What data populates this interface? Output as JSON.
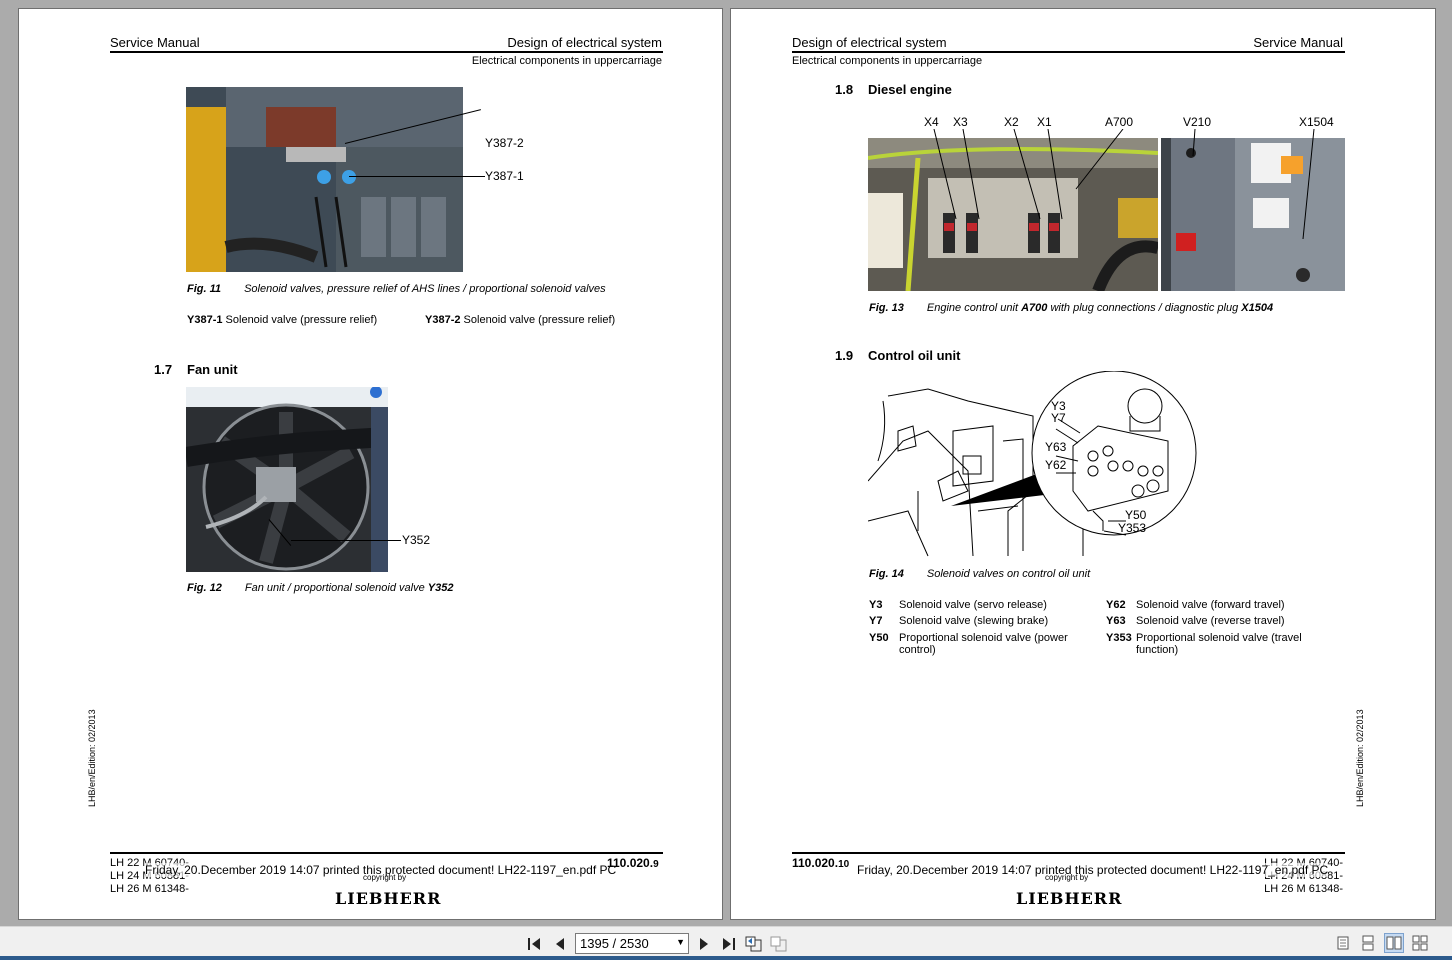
{
  "left_page": {
    "header_left": "Service Manual",
    "header_right": "Design of electrical system",
    "header_sub": "Electrical components in uppercarriage",
    "fig11": {
      "callouts": [
        "Y387-2",
        "Y387-1"
      ],
      "label": "Fig. 11",
      "caption": "Solenoid valves, pressure relief of AHS lines / proportional solenoid valves",
      "legend": [
        {
          "code": "Y387-1",
          "text": "Solenoid valve (pressure relief)"
        },
        {
          "code": "Y387-2",
          "text": "Solenoid valve (pressure relief)"
        }
      ]
    },
    "section": {
      "number": "1.7",
      "title": "Fan unit"
    },
    "fig12": {
      "callout": "Y352",
      "label": "Fig. 12",
      "caption": "Fan unit / proportional solenoid valve",
      "caption_bold": "Y352"
    },
    "side_text": "LHB/en/Edition: 02/2013",
    "footer_models": [
      "LH 22 M 60740-",
      "LH 24 M 60881-",
      "LH 26 M 61348-"
    ],
    "page_number": "110.020.",
    "page_number_small": "9",
    "copyright": "copyright by",
    "logo": "LIEBHERR",
    "printed": "Friday, 20.December 2019 14:07 printed this protected document! LH22-1197_en.pdf PC"
  },
  "right_page": {
    "header_left": "Design of electrical system",
    "header_right": "Service Manual",
    "header_sub": "Electrical components in uppercarriage",
    "section18": {
      "number": "1.8",
      "title": "Diesel engine"
    },
    "fig13": {
      "callouts": [
        "X4",
        "X3",
        "X2",
        "X1",
        "A700",
        "V210",
        "X1504"
      ],
      "label": "Fig. 13",
      "caption_a": "Engine control unit",
      "caption_b1": "A700",
      "caption_c": "with plug connections / diagnostic plug",
      "caption_b2": "X1504"
    },
    "section19": {
      "number": "1.9",
      "title": "Control oil unit"
    },
    "fig14": {
      "callouts": [
        "Y3",
        "Y7",
        "Y63",
        "Y62",
        "Y50",
        "Y353"
      ],
      "label": "Fig. 14",
      "caption": "Solenoid valves on control oil unit",
      "legend": [
        {
          "code": "Y3",
          "text": "Solenoid valve (servo release)"
        },
        {
          "code": "Y62",
          "text": "Solenoid valve (forward travel)"
        },
        {
          "code": "Y7",
          "text": "Solenoid valve (slewing brake)"
        },
        {
          "code": "Y63",
          "text": "Solenoid valve (reverse travel)"
        },
        {
          "code": "Y50",
          "text": "Proportional solenoid valve (power control)"
        },
        {
          "code": "Y353",
          "text": "Proportional solenoid valve (travel function)"
        }
      ]
    },
    "side_text": "LHB/en/Edition: 02/2013",
    "footer_models": [
      "LH 22 M 60740-",
      "LH 24 M 60881-",
      "LH 26 M 61348-"
    ],
    "page_number": "110.020.",
    "page_number_small": "10",
    "copyright": "copyright by",
    "logo": "LIEBHERR",
    "printed": "Friday, 20.December 2019 14:07 printed this protected document! LH22-1197_en.pdf PC"
  },
  "toolbar": {
    "page_field": "1395 / 2530"
  }
}
